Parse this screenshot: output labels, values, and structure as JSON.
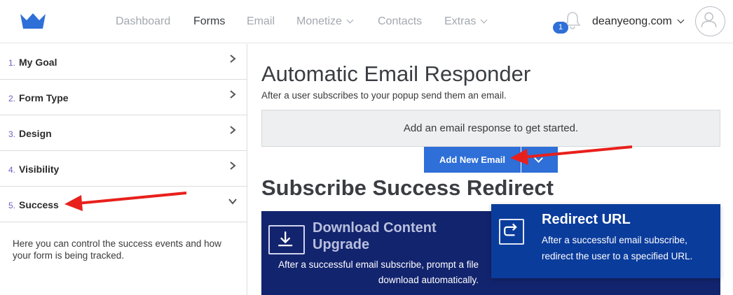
{
  "nav": {
    "items": [
      {
        "label": "Dashboard",
        "active": false,
        "dropdown": false
      },
      {
        "label": "Forms",
        "active": true,
        "dropdown": false
      },
      {
        "label": "Email",
        "active": false,
        "dropdown": false
      },
      {
        "label": "Monetize",
        "active": false,
        "dropdown": true
      },
      {
        "label": "Contacts",
        "active": false,
        "dropdown": false
      },
      {
        "label": "Extras",
        "active": false,
        "dropdown": true
      }
    ],
    "notification_count": "1",
    "account_name": "deanyeong.com",
    "logo_icon": "crown-logo-icon",
    "bell_icon": "bell-icon",
    "avatar_icon": "user-avatar-icon"
  },
  "sidebar": {
    "steps": [
      {
        "number": "1.",
        "label": "My Goal",
        "state": "collapsed"
      },
      {
        "number": "2.",
        "label": "Form Type",
        "state": "collapsed"
      },
      {
        "number": "3.",
        "label": "Design",
        "state": "collapsed"
      },
      {
        "number": "4.",
        "label": "Visibility",
        "state": "collapsed"
      },
      {
        "number": "5.",
        "label": "Success",
        "state": "expanded"
      }
    ],
    "description": "Here you can control the success events and how your form is being tracked."
  },
  "main": {
    "responder_title": "Automatic Email Responder",
    "responder_subtitle": "After a user subscribes to your popup send them an email.",
    "empty_message": "Add an email response to get started.",
    "add_button_label": "Add New Email",
    "redirect_title": "Subscribe Success Redirect",
    "cards": {
      "download": {
        "title": "Download Content Upgrade",
        "description": "After a successful email subscribe, prompt a file download automatically.",
        "icon": "download-icon"
      },
      "redirect": {
        "title": "Redirect URL",
        "description": "After a successful email subscribe, redirect the user to a specified URL.",
        "icon": "redirect-arrow-icon"
      }
    }
  },
  "colors": {
    "primary_blue": "#2f6fd8",
    "card_dark_navy": "#13246e",
    "card_selected_blue": "#0a3c9c",
    "annotation_red": "#e8201c",
    "step_number_purple": "#6a5fc4"
  }
}
